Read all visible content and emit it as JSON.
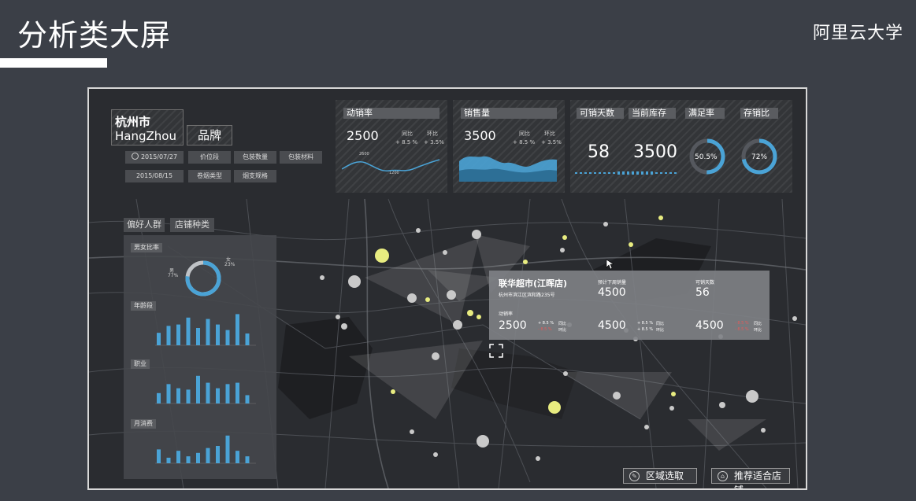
{
  "slide": {
    "title": "分析类大屏",
    "brand": "阿里云大学"
  },
  "colors": {
    "accent": "#4aa3d6",
    "marker_yellow": "#e8ec80",
    "marker_grey": "#c9c9c9",
    "background": "#26282b"
  },
  "filters": {
    "city_cn": "杭州市",
    "city_en": "HangZhou",
    "category": "品牌",
    "date1": "2015/07/27",
    "date2": "2015/08/15",
    "tags_row1": [
      "价位段",
      "包装数量",
      "包装材料"
    ],
    "tags_row2": [
      "卷烟类型",
      "烟支规格"
    ]
  },
  "kpis": {
    "movement": {
      "title": "动销率",
      "value": "2500",
      "yoy_label": "同比",
      "mom_label": "环比",
      "yoy": "+ 8.5 %",
      "mom": "+ 3.5%",
      "mark_hi": "2600",
      "mark_lo": "1200"
    },
    "sales": {
      "title": "销售量",
      "value": "3500",
      "yoy_label": "同比",
      "mom_label": "环比",
      "yoy": "+ 8.5 %",
      "mom": "+ 3.5%"
    },
    "days": {
      "title": "可销天数",
      "value": "58"
    },
    "stock": {
      "title": "当前库存",
      "value": "3500"
    },
    "satisfy": {
      "title": "满足率",
      "value": "50.5%",
      "fraction": 0.505
    },
    "stock_ratio": {
      "title": "存销比",
      "value": "72%",
      "fraction": 0.72
    }
  },
  "left_tabs": [
    "偏好人群",
    "店铺种类"
  ],
  "demographics": {
    "gender_title": "男女比率",
    "male_label": "男",
    "male_pct": "77%",
    "female_label": "女",
    "female_pct": "23%",
    "male_fraction": 0.77,
    "age_title": "年龄段",
    "job_title": "职业",
    "spend_title": "月消费"
  },
  "chart_data": [
    {
      "type": "bar",
      "title": "年龄段",
      "values": [
        18,
        28,
        30,
        40,
        25,
        38,
        30,
        22,
        45,
        17
      ],
      "ylim": [
        0,
        50
      ]
    },
    {
      "type": "bar",
      "title": "职业",
      "values": [
        15,
        28,
        22,
        20,
        40,
        30,
        22,
        28,
        30,
        12
      ],
      "ylim": [
        0,
        50
      ]
    },
    {
      "type": "bar",
      "title": "月消费",
      "values": [
        20,
        8,
        18,
        10,
        15,
        22,
        25,
        40,
        18,
        10
      ],
      "ylim": [
        0,
        50
      ]
    }
  ],
  "tooltip": {
    "store_name": "联华超市(江晖店)",
    "address": "杭州市滨江区滨和路235号",
    "forecast_label": "预计下周销量",
    "forecast_value": "4500",
    "days_label": "可销天数",
    "days_value": "56",
    "rate_label": "动销率",
    "rate_value": "2500",
    "val2": "4500",
    "val3": "4500",
    "change_up": "+ 8.5 %",
    "change_down": "- 8.5 %",
    "yoy_label": "同比",
    "mom_label": "环比"
  },
  "buttons": {
    "area_select": "区域选取",
    "recommend": "推荐适合店铺"
  }
}
